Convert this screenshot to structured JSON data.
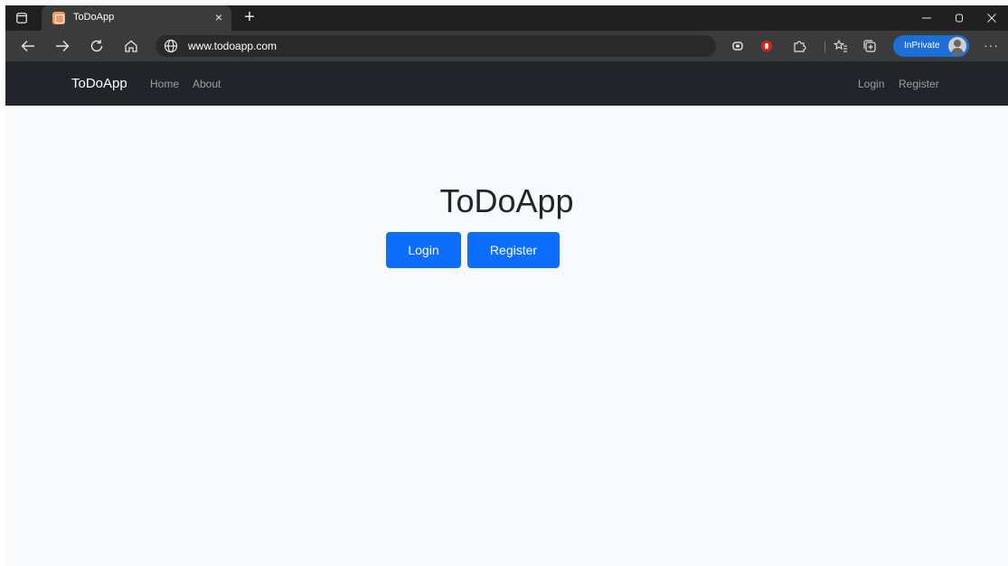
{
  "browser": {
    "tab_title": "ToDoApp",
    "tab_close": "×",
    "new_tab": "+",
    "url": "www.todoapp.com",
    "inprivate_label": "InPrivate",
    "more": "···",
    "icons": [
      "tab-actions-icon",
      "back-icon",
      "forward-icon",
      "refresh-icon",
      "home-icon",
      "globe-icon",
      "read-aloud-icon",
      "stop-tracking-icon",
      "extensions-icon",
      "favorites-icon",
      "collections-icon",
      "profile-icon",
      "more-icon",
      "minimize-icon",
      "restore-icon",
      "close-icon"
    ]
  },
  "navbar": {
    "brand": "ToDoApp",
    "left_links": [
      "Home",
      "About"
    ],
    "right_links": [
      "Login",
      "Register"
    ]
  },
  "hero": {
    "title": "ToDoApp",
    "login_button": "Login",
    "register_button": "Register"
  },
  "colors": {
    "navbar_bg": "#212529",
    "page_bg": "#f8f9fa",
    "primary": "#0d6efd",
    "inprivate": "#1b6fd6"
  }
}
